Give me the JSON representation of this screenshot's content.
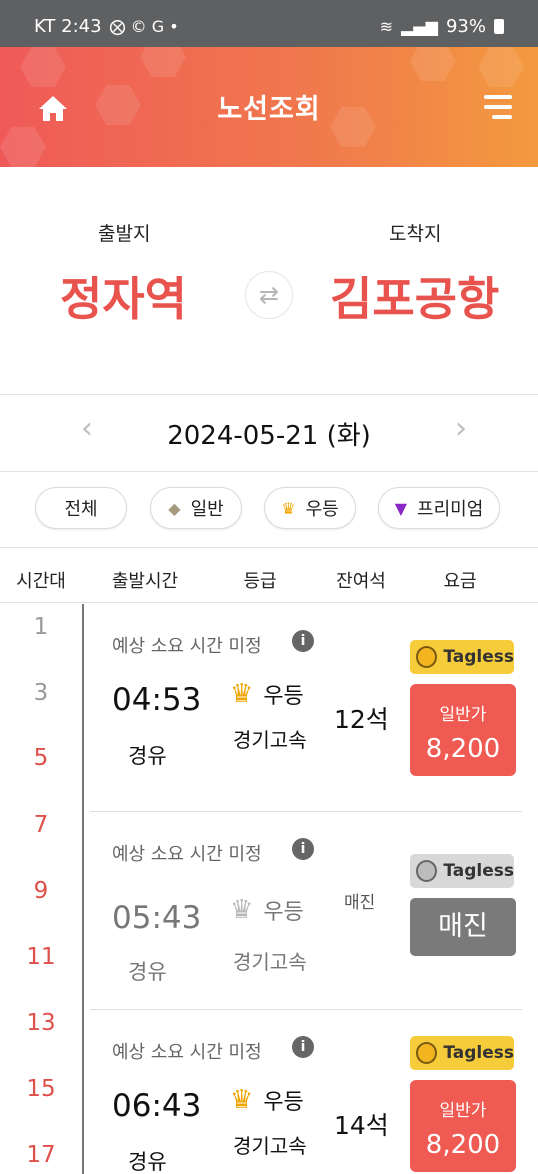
{
  "status_bar": {
    "carrier_time": "KT 2:43",
    "left_icons": "⨂ © G •",
    "battery_percent": "93%"
  },
  "header": {
    "title": "노선조회"
  },
  "route": {
    "origin_label": "출발지",
    "origin": "정자역",
    "destination_label": "도착지",
    "destination": "김포공항"
  },
  "date": {
    "value": "2024-05-21 (화)"
  },
  "filters": [
    {
      "label": "전체",
      "icon": ""
    },
    {
      "label": "일반",
      "icon": "diamond-icon",
      "color": "#a89a7e"
    },
    {
      "label": "우등",
      "icon": "crown-icon",
      "color": "#f0a500"
    },
    {
      "label": "프리미엄",
      "icon": "gem-icon",
      "color": "#8a27c4"
    }
  ],
  "columns": [
    "시간대",
    "출발시간",
    "등급",
    "잔여석",
    "요금"
  ],
  "timeline": [
    "1",
    "3",
    "5",
    "7",
    "9",
    "11",
    "13",
    "15",
    "17"
  ],
  "trips": [
    {
      "note": "예상 소요 시간 미정",
      "time": "04:53",
      "via": "경유",
      "grade": "우등",
      "company": "경기고속",
      "seats": "12석",
      "tag": "Tagless",
      "price_label": "일반가",
      "price": "8,200",
      "sold_out": false
    },
    {
      "note": "예상 소요 시간 미정",
      "time": "05:43",
      "via": "경유",
      "grade": "우등",
      "company": "경기고속",
      "seats_status": "매진",
      "tag": "Tagless",
      "button": "매진",
      "sold_out": true
    },
    {
      "note": "예상 소요 시간 미정",
      "time": "06:43",
      "via": "경유",
      "grade": "우등",
      "company": "경기고속",
      "seats": "14석",
      "tag": "Tagless",
      "price_label": "일반가",
      "price": "8,200",
      "sold_out": false
    }
  ],
  "colors": {
    "accent": "#ef5a58",
    "accent_end": "#f39a3f",
    "price_button": "#ef5a52",
    "timeline_red": "#e0504b"
  }
}
